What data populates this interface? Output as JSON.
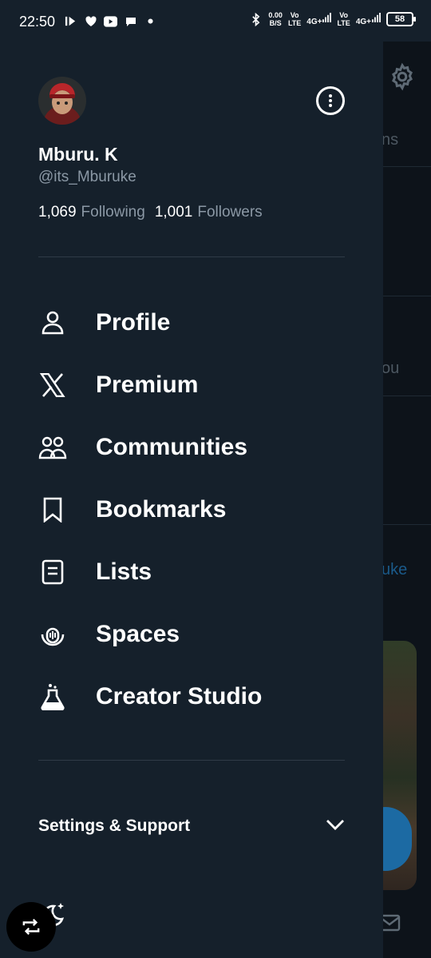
{
  "status_bar": {
    "time": "22:50",
    "net_speed_value": "0.00",
    "net_speed_unit": "B/S",
    "sim1_label": "Vo\nLTE",
    "sim1_net": "4G+",
    "sim2_label": "Vo\nLTE",
    "sim2_net": "4G+",
    "battery": "58"
  },
  "profile": {
    "display_name": "Mburu. K",
    "handle": "@its_Mburuke",
    "following_count": "1,069",
    "following_label": "Following",
    "followers_count": "1,001",
    "followers_label": "Followers"
  },
  "menu": {
    "items": [
      {
        "label": "Profile",
        "icon": "person-icon"
      },
      {
        "label": "Premium",
        "icon": "x-logo-icon"
      },
      {
        "label": "Communities",
        "icon": "communities-icon"
      },
      {
        "label": "Bookmarks",
        "icon": "bookmark-icon"
      },
      {
        "label": "Lists",
        "icon": "list-icon"
      },
      {
        "label": "Spaces",
        "icon": "spaces-icon"
      },
      {
        "label": "Creator Studio",
        "icon": "flask-icon"
      }
    ]
  },
  "settings": {
    "label": "Settings & Support"
  },
  "background": {
    "partial_text_1": "ns",
    "partial_text_2": "ou",
    "partial_text_3": "uke"
  },
  "colors": {
    "drawer_bg": "#15202b",
    "muted_text": "#8b98a5",
    "divider": "#2f3b47",
    "accent": "#1d9bf0"
  }
}
